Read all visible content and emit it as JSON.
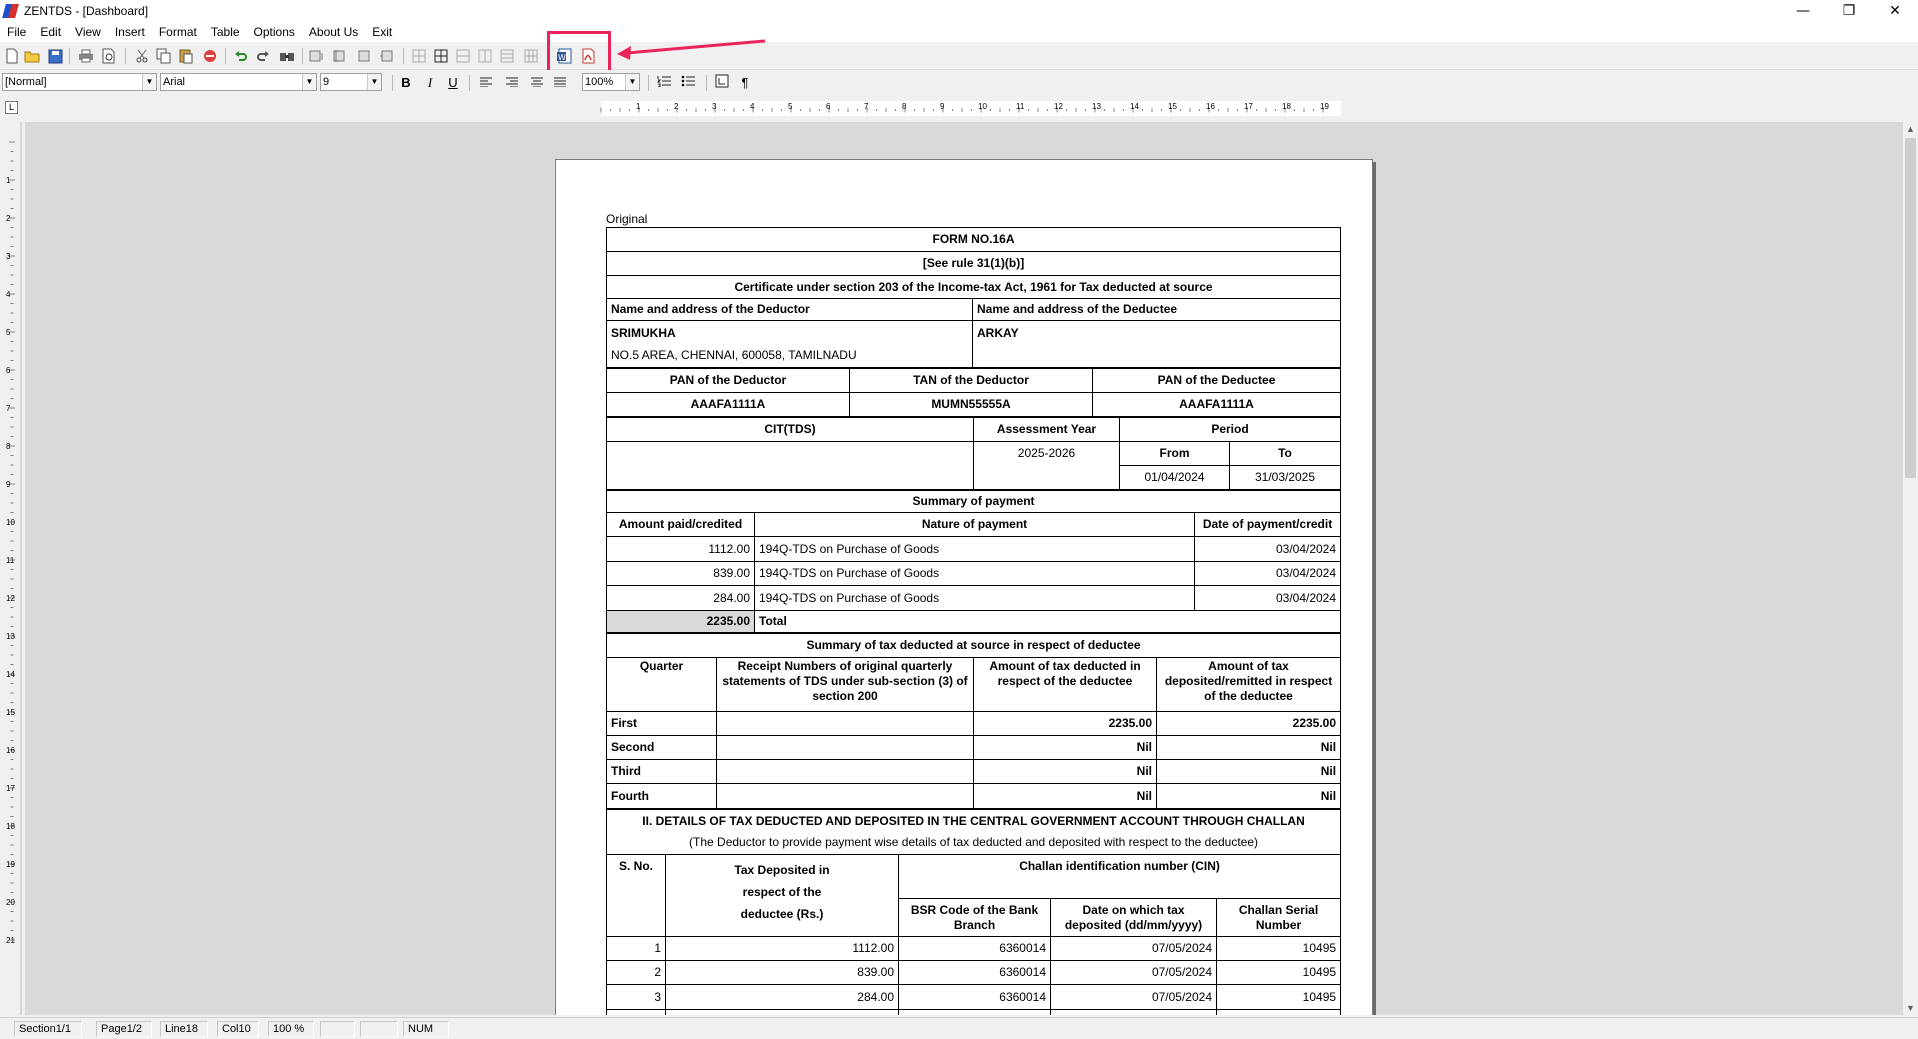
{
  "window": {
    "title": "ZENTDS - [Dashboard]",
    "controls": {
      "minimize": "—",
      "restore": "❐",
      "close": "✕"
    }
  },
  "menu": [
    "File",
    "Edit",
    "View",
    "Insert",
    "Format",
    "Table",
    "Options",
    "About Us",
    "Exit"
  ],
  "toolbar": {
    "icons": [
      "new-document-icon",
      "open-folder-icon",
      "save-icon",
      "print-icon",
      "print-preview-icon",
      "cut-icon",
      "copy-icon",
      "paste-icon",
      "stop-icon",
      "undo-icon",
      "redo-icon",
      "find-icon",
      "table-tool-1-icon",
      "table-tool-2-icon",
      "table-tool-3-icon",
      "table-tool-4-icon",
      "insert-table-icon",
      "table-borders-icon",
      "merge-cells-icon",
      "split-cells-icon",
      "insert-row-icon",
      "delete-row-icon",
      "export-word-icon",
      "export-pdf-icon"
    ],
    "highlight_color": "#e8245a"
  },
  "format_bar": {
    "style": "[Normal]",
    "font": "Arial",
    "size": "9",
    "zoom": "100%",
    "bold": "B",
    "italic": "I",
    "underline": "U",
    "pilcrow": "¶"
  },
  "ruler": {
    "labels": [
      "1",
      "2",
      "3",
      "4",
      "5",
      "6",
      "7",
      "8",
      "9",
      "10",
      "11",
      "12",
      "13",
      "14",
      "15",
      "16",
      "17",
      "18",
      "19"
    ],
    "vlabels": [
      "1",
      "2",
      "3",
      "4",
      "5",
      "6",
      "7",
      "8",
      "9",
      "10",
      "11",
      "12",
      "13",
      "14",
      "15",
      "16",
      "17",
      "18",
      "19",
      "20",
      "21"
    ]
  },
  "status": {
    "section": "Section1/1",
    "page": "Page1/2",
    "line": "Line18",
    "col": "Col10",
    "zoom": "100 %",
    "num": "NUM"
  },
  "document": {
    "original": "Original",
    "form_no": "FORM NO.16A",
    "rule": "[See rule 31(1)(b)]",
    "certificate": "Certificate under section 203 of the Income-tax Act, 1961 for Tax deducted at source",
    "deductor_hdr": "Name and address of the Deductor",
    "deductee_hdr": "Name and address of the Deductee",
    "deductor_name": "SRIMUKHA",
    "deductor_addr": "NO.5 AREA, CHENNAI, 600058, TAMILNADU",
    "deductee_name": "ARKAY",
    "pan_deductor_hdr": "PAN of the Deductor",
    "tan_deductor_hdr": "TAN of the Deductor",
    "pan_deductee_hdr": "PAN of the Deductee",
    "pan_deductor": "AAAFA1111A",
    "tan_deductor": "MUMN55555A",
    "pan_deductee": "AAAFA1111A",
    "cit_hdr": "CIT(TDS)",
    "ay_hdr": "Assessment Year",
    "period_hdr": "Period",
    "ay": "2025-2026",
    "from_hdr": "From",
    "to_hdr": "To",
    "from": "01/04/2024",
    "to": "31/03/2025",
    "summary_payment": "Summary of payment",
    "payment_cols": [
      "Amount paid/credited",
      "Nature of payment",
      "Date of payment/credit"
    ],
    "payments": [
      {
        "amount": "1112.00",
        "nature": "194Q-TDS on Purchase of Goods",
        "date": "03/04/2024"
      },
      {
        "amount": "839.00",
        "nature": "194Q-TDS on Purchase of Goods",
        "date": "03/04/2024"
      },
      {
        "amount": "284.00",
        "nature": "194Q-TDS on Purchase of Goods",
        "date": "03/04/2024"
      }
    ],
    "total_amount": "2235.00",
    "total_label": "Total",
    "summary_tax": "Summary of tax deducted at source in respect of deductee",
    "quarter_cols": [
      "Quarter",
      "Receipt Numbers of original quarterly statements of TDS under sub-section (3) of section 200",
      "Amount of tax deducted in respect of the deductee",
      "Amount of tax deposited/remitted in respect of the deductee"
    ],
    "quarters": [
      {
        "q": "First",
        "receipt": "",
        "deducted": "2235.00",
        "deposited": "2235.00"
      },
      {
        "q": "Second",
        "receipt": "",
        "deducted": "Nil",
        "deposited": "Nil"
      },
      {
        "q": "Third",
        "receipt": "",
        "deducted": "Nil",
        "deposited": "Nil"
      },
      {
        "q": "Fourth",
        "receipt": "",
        "deducted": "Nil",
        "deposited": "Nil"
      }
    ],
    "challan_title": "II. DETAILS OF TAX DEDUCTED AND DEPOSITED IN THE CENTRAL GOVERNMENT ACCOUNT THROUGH CHALLAN",
    "challan_sub": "(The Deductor to provide payment wise details of tax deducted and deposited with respect to the deductee)",
    "sno_hdr": "S. No.",
    "tax_dep_hdr": [
      "Tax Deposited in",
      "respect of the",
      "deductee (Rs.)"
    ],
    "cin_hdr": "Challan identification number (CIN)",
    "bsr_hdr": "BSR Code of the Bank Branch",
    "date_dep_hdr": "Date on which tax deposited (dd/mm/yyyy)",
    "serial_hdr": "Challan Serial Number",
    "challans": [
      {
        "sno": "1",
        "tax": "1112.00",
        "bsr": "6360014",
        "date": "07/05/2024",
        "serial": "10495"
      },
      {
        "sno": "2",
        "tax": "839.00",
        "bsr": "6360014",
        "date": "07/05/2024",
        "serial": "10495"
      },
      {
        "sno": "3",
        "tax": "284.00",
        "bsr": "6360014",
        "date": "07/05/2024",
        "serial": "10495"
      }
    ]
  }
}
